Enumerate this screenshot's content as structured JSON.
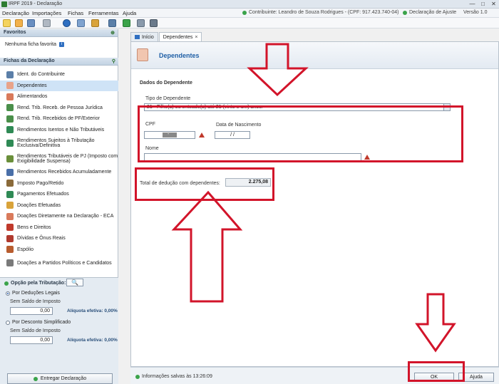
{
  "window": {
    "title": "IRPF 2019 - Declaração",
    "controls": [
      "—",
      "□",
      "✕"
    ]
  },
  "menubar": {
    "items": [
      "Declaração",
      "Importações",
      "Fichas",
      "Ferramentas",
      "Ajuda"
    ],
    "contribuinte": "Contribuinte: Leandro de Souza Rodrigues - (CPF: 917.423.740-04)",
    "tipo_declaracao": "Declaração de Ajuste",
    "versao": "Versão 1.0"
  },
  "left": {
    "favoritos_header": "Favoritos",
    "favoritos_text": "Nenhuma ficha favorita",
    "fichas_header": "Fichas da Declaração",
    "fichas": [
      {
        "label": "Ident. do Contribuinte",
        "color": "#5b7fa8"
      },
      {
        "label": "Dependentes",
        "color": "#e8a38a"
      },
      {
        "label": "Alimentandos",
        "color": "#d97a5b"
      },
      {
        "label": "Rend. Trib. Receb. de Pessoa Jurídica",
        "color": "#4a8f4a"
      },
      {
        "label": "Rend. Trib. Recebidos de PF/Exterior",
        "color": "#4a8f4a"
      },
      {
        "label": "Rendimentos Isentos e Não Tributáveis",
        "color": "#2f8a55"
      },
      {
        "label": "Rendimentos Sujeitos à Tributação Exclusiva/Definitiva",
        "color": "#2f8a55"
      },
      {
        "label": "Rendimentos Tributáveis de PJ (Imposto com Exigibilidade Suspensa)",
        "color": "#6a8f3a"
      },
      {
        "label": "Rendimentos Recebidos Acumuladamente",
        "color": "#4a6fa8"
      },
      {
        "label": "Imposto Pago/Retido",
        "color": "#8a6a3a"
      },
      {
        "label": "Pagamentos Efetuados",
        "color": "#2f8a55"
      },
      {
        "label": "Doações Efetuadas",
        "color": "#d9a33a"
      },
      {
        "label": "Doações Diretamente na Declaração - ECA",
        "color": "#d97a5b"
      },
      {
        "label": "Bens e Direitos",
        "color": "#c0392b"
      },
      {
        "label": "Dívidas e Ônus Reais",
        "color": "#b03a2e"
      },
      {
        "label": "Espólio",
        "color": "#b85c2e"
      },
      {
        "label": "Doações a Partidos Políticos e Candidatos",
        "color": "#7a7a7a"
      }
    ],
    "opcao": {
      "label": "Opção pela Tributação:",
      "search_symbol": "🔍",
      "deducoes_label": "Por Deduções Legais",
      "deducoes_saldo_label": "Sem Saldo de Imposto",
      "deducoes_valor": "0,00",
      "deducoes_aliquota": "Alíquota efetiva: 0,00%",
      "simplificado_label": "Por Desconto Simplificado",
      "simplificado_saldo_label": "Sem Saldo de Imposto",
      "simplificado_valor": "0,00",
      "simplificado_aliquota": "Alíquota efetiva: 0,00%",
      "entregar_label": "Entregar Declaração"
    }
  },
  "tabs": [
    {
      "label": "Início",
      "active": false
    },
    {
      "label": "Dependentes",
      "active": true,
      "close": "×"
    }
  ],
  "page": {
    "title": "Dependentes",
    "dados_title": "Dados do Dependente",
    "tipo_label": "Tipo de Dependente",
    "tipo_value": "21 - Filho(a) ou enteado(a) até 21 (vinte e um) anos.",
    "cpf_label": "CPF",
    "cpf_mask": "-",
    "nascimento_label": "Data de Nascimento",
    "nascimento_value": "/ /",
    "nome_label": "Nome",
    "total_label": "Total de dedução com dependentes:",
    "total_value": "2.275,08"
  },
  "status": {
    "text": "Informações salvas às 13:26:09",
    "ok_label": "OK",
    "ajuda_label": "Ajuda"
  },
  "colors": {
    "highlight": "#d2142a",
    "accent": "#1f5fa6"
  }
}
